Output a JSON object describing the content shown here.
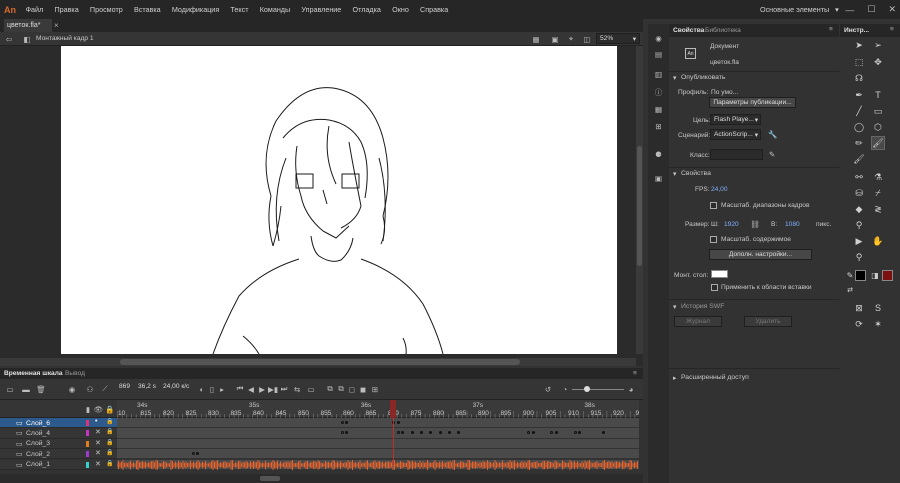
{
  "app": {
    "logo": "An"
  },
  "menu": [
    "Файл",
    "Правка",
    "Просмотр",
    "Вставка",
    "Модификация",
    "Текст",
    "Команды",
    "Управление",
    "Отладка",
    "Окно",
    "Справка"
  ],
  "workspace": "Основные элементы",
  "document": {
    "tab": "цветок.fla*",
    "scene": "Монтажный кадр 1",
    "zoom": "52%"
  },
  "timeline": {
    "tabs": [
      "Временная шкала",
      "Вывод"
    ],
    "current_frame": "869",
    "time": "36,2 s",
    "fps": "24,00 к/с",
    "seconds": [
      {
        "label": "34s",
        "frame": 810
      },
      {
        "label": "35s",
        "frame": 834
      },
      {
        "label": "36s",
        "frame": 858
      },
      {
        "label": "37s",
        "frame": 882
      },
      {
        "label": "38s",
        "frame": 906
      }
    ],
    "ruler_start": 810,
    "ruler_end": 922,
    "playhead": 869,
    "ticks": [
      "10",
      "815",
      "820",
      "825",
      "830",
      "835",
      "840",
      "845",
      "850",
      "855",
      "860",
      "865",
      "870",
      "875",
      "880",
      "885",
      "890",
      "895",
      "900",
      "905",
      "910",
      "915",
      "920",
      "92"
    ],
    "layers": [
      {
        "name": "Слой_6",
        "color": "#e0327a",
        "selected": true,
        "keyframes": [
          {
            "frame": 858,
            "filled": false
          },
          {
            "frame": 859,
            "filled": true
          },
          {
            "frame": 869,
            "filled": false
          },
          {
            "frame": 870,
            "filled": true
          }
        ]
      },
      {
        "name": "Слой_4",
        "color": "#c533c5",
        "selected": false,
        "keyframes": [
          {
            "frame": 858,
            "filled": false
          },
          {
            "frame": 859,
            "filled": true
          },
          {
            "frame": 870,
            "filled": false
          },
          {
            "frame": 871,
            "filled": true
          },
          {
            "frame": 873,
            "filled": true
          },
          {
            "frame": 875,
            "filled": true
          },
          {
            "frame": 877,
            "filled": true
          },
          {
            "frame": 879,
            "filled": true
          },
          {
            "frame": 881,
            "filled": true
          },
          {
            "frame": 883,
            "filled": true
          },
          {
            "frame": 898,
            "filled": false
          },
          {
            "frame": 899,
            "filled": true
          },
          {
            "frame": 903,
            "filled": false
          },
          {
            "frame": 904,
            "filled": true
          },
          {
            "frame": 908,
            "filled": false
          },
          {
            "frame": 909,
            "filled": true
          },
          {
            "frame": 914,
            "filled": true
          }
        ]
      },
      {
        "name": "Слой_3",
        "color": "#e07c1f",
        "selected": false,
        "keyframes": []
      },
      {
        "name": "Слой_2",
        "color": "#9a3ad0",
        "selected": false,
        "keyframes": [
          {
            "frame": 826,
            "filled": false
          },
          {
            "frame": 827,
            "filled": true
          }
        ]
      },
      {
        "name": "Слой_1",
        "color": "#3ad0d0",
        "selected": false,
        "keyframes": []
      }
    ]
  },
  "properties": {
    "tabs": [
      "Свойства",
      "Библиотека"
    ],
    "doc_type": "Документ",
    "doc_name": "цветок.fla",
    "publish_section": "Опубликовать",
    "profile_label": "Профиль:",
    "profile_value": "По умо...",
    "publish_settings_btn": "Параметры публикации...",
    "target_label": "Цель:",
    "target_value": "Flash Playe...",
    "script_label": "Сценарий:",
    "script_value": "ActionScrip...",
    "class_label": "Класс:",
    "props_section": "Свойства",
    "fps_label": "FPS:",
    "fps_value": "24,00",
    "scale_spans_label": "Масштаб. диапазоны кадров",
    "size_label": "Размер:",
    "w_label": "Ш:",
    "w_value": "1920",
    "h_label": "В:",
    "h_value": "1080",
    "unit": "пикс.",
    "scale_content_label": "Масштаб. содержимое",
    "advanced_btn": "Дополн. настройки...",
    "stage_label": "Монт. стол:",
    "stage_color": "#ffffff",
    "apply_paste_label": "Применить к области вставки",
    "history_section": "История SWF",
    "log_btn": "Журнал",
    "clear_btn": "Удалить",
    "advanced_access": "Расширенный доступ"
  },
  "tools": {
    "tab": "Инстр...",
    "stroke_color": "#000000",
    "fill_color": "#7a1010"
  },
  "colors": {
    "playhead": "#c02d2d",
    "waveform": "#e8622a",
    "selection": "#2d5a8c"
  }
}
